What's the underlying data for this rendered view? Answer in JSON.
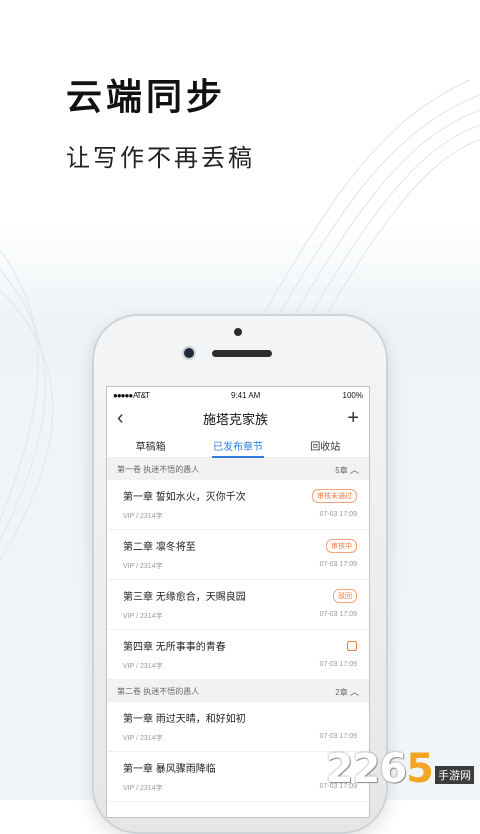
{
  "hero": {
    "title": "云端同步",
    "subtitle": "让写作不再丢稿"
  },
  "status": {
    "carrier": "●●●●● AT&T",
    "time": "9:41 AM",
    "battery": "100%"
  },
  "nav": {
    "title": "施塔克家族",
    "back_icon": "‹",
    "add_icon": "+"
  },
  "tabs": [
    "草稿箱",
    "已发布章节",
    "回收站"
  ],
  "volumes": [
    {
      "name": "第一卷   执迷不悟的愚人",
      "count": "5章",
      "chapters": [
        {
          "title": "第一章   誓如水火，灭你千次",
          "meta": "VIP / 2314字",
          "date": "07-03  17:09",
          "badge": "审核未通过"
        },
        {
          "title": "第二章   凛冬将至",
          "meta": "VIP / 2314字",
          "date": "07-03  17:09",
          "badge": "审核中"
        },
        {
          "title": "第三章   无缘愈合，天赐良园",
          "meta": "VIP / 2314字",
          "date": "07-03  17:09",
          "badge": "驳回"
        },
        {
          "title": "第四章   无所事事的青春",
          "meta": "VIP / 2314字",
          "date": "07-03  17:09",
          "badge": ""
        }
      ]
    },
    {
      "name": "第二卷   执迷不悟的愚人",
      "count": "2章",
      "chapters": [
        {
          "title": "第一章   雨过天晴，和好如初",
          "meta": "VIP / 2314字",
          "date": "07-03  17:09",
          "badge": ""
        },
        {
          "title": "第一章   暴风骤雨降临",
          "meta": "VIP / 2314字",
          "date": "07-03  17:09",
          "badge": ""
        }
      ]
    }
  ],
  "logo": {
    "num_a": "22",
    "num_b": "6",
    "num_c": "5",
    "tag": "手游网"
  },
  "colors": {
    "accent": "#2f7de1",
    "warning": "#f07b3f"
  }
}
